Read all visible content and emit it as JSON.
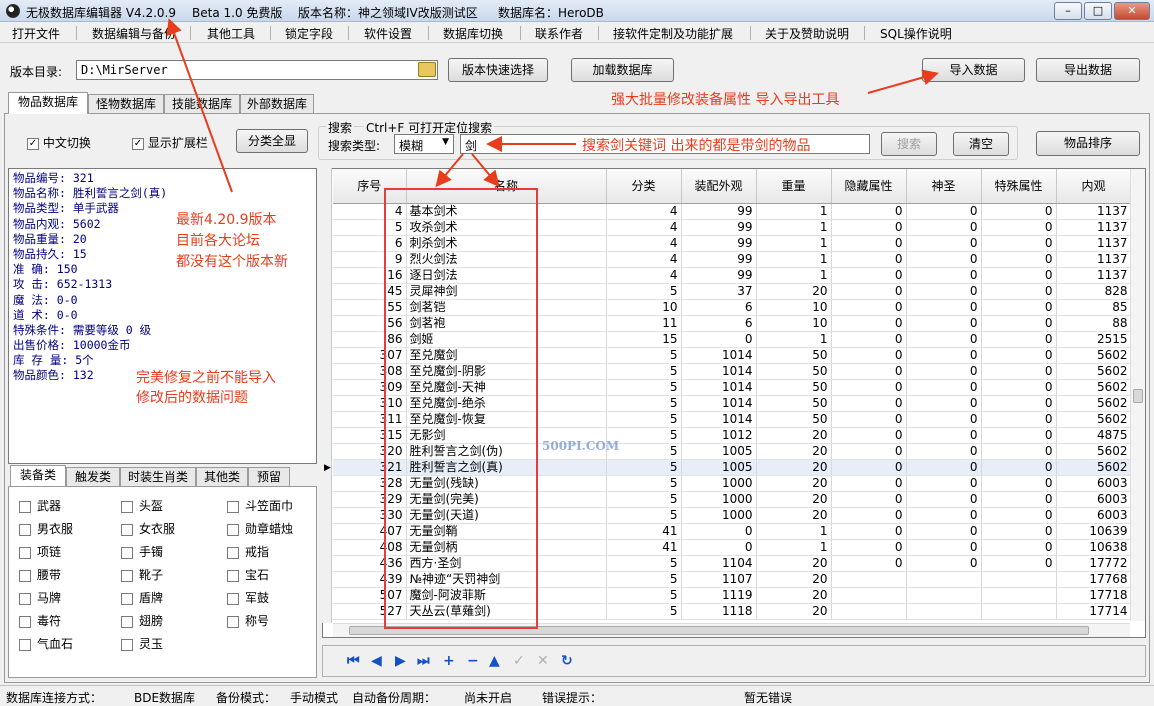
{
  "window": {
    "title": "无极数据库编辑器 V4.2.0.9",
    "edition": "Beta 1.0 免费版",
    "version_name": "版本名称：神之领域IV改版测试区",
    "db_name": "数据库名：HeroDB",
    "minimize": "–",
    "maximize": "□",
    "close": "✕"
  },
  "menu": [
    "打开文件",
    "数据编辑与备份",
    "其他工具",
    "锁定字段",
    "软件设置",
    "数据库切换",
    "联系作者",
    "接软件定制及功能扩展",
    "关于及赞助说明",
    "SQL操作说明"
  ],
  "toolbar": {
    "dir_label": "版本目录:",
    "dir_value": "D:\\MirServer",
    "quick_select": "版本快速选择",
    "load_db": "加载数据库",
    "import": "导入数据",
    "export": "导出数据"
  },
  "tabs": [
    "物品数据库",
    "怪物数据库",
    "技能数据库",
    "外部数据库"
  ],
  "options": {
    "chinese_toggle": "中文切换",
    "show_ext": "显示扩展栏",
    "category_all": "分类全显"
  },
  "search": {
    "title": "搜索",
    "hint": "Ctrl+F 可打开定位搜索",
    "type_label": "搜索类型:",
    "type_value": "模糊",
    "keyword": "剑",
    "search_btn": "搜索",
    "clear_btn": "清空",
    "sort_btn": "物品排序"
  },
  "item_info": [
    "物品编号: 321",
    "物品名称: 胜利誓言之剑(真)",
    "物品类型: 单手武器",
    "物品内观: 5602",
    "物品重量: 20",
    "物品持久: 15",
    "准    确: 150",
    "攻    击: 652-1313",
    "魔    法: 0-0",
    "道    术: 0-0",
    "特殊条件: 需要等级 0 级",
    "出售价格: 10000金币",
    "库 存 量: 5个",
    "物品颜色: 132"
  ],
  "category_tabs": [
    "装备类",
    "触发类",
    "时装生肖类",
    "其他类",
    "预留"
  ],
  "categories": [
    "武器",
    "头盔",
    "斗笠面巾",
    "男衣服",
    "女衣服",
    "勋章蜡烛",
    "项链",
    "手镯",
    "戒指",
    "腰带",
    "靴子",
    "宝石",
    "马牌",
    "盾牌",
    "军鼓",
    "毒符",
    "翅膀",
    "称号",
    "气血石",
    "灵玉"
  ],
  "grid": {
    "columns": [
      "序号",
      "名称",
      "分类",
      "装配外观",
      "重量",
      "隐藏属性",
      "神圣",
      "特殊属性",
      "内观"
    ],
    "rows": [
      [
        "4",
        "基本剑术",
        "4",
        "99",
        "1",
        "0",
        "0",
        "0",
        "1137"
      ],
      [
        "5",
        "攻杀剑术",
        "4",
        "99",
        "1",
        "0",
        "0",
        "0",
        "1137"
      ],
      [
        "6",
        "刺杀剑术",
        "4",
        "99",
        "1",
        "0",
        "0",
        "0",
        "1137"
      ],
      [
        "9",
        "烈火剑法",
        "4",
        "99",
        "1",
        "0",
        "0",
        "0",
        "1137"
      ],
      [
        "16",
        "逐日剑法",
        "4",
        "99",
        "1",
        "0",
        "0",
        "0",
        "1137"
      ],
      [
        "45",
        "灵犀神剑",
        "5",
        "37",
        "20",
        "0",
        "0",
        "0",
        "828"
      ],
      [
        "55",
        "剑茗铠",
        "10",
        "6",
        "10",
        "0",
        "0",
        "0",
        "85"
      ],
      [
        "56",
        "剑茗袍",
        "11",
        "6",
        "10",
        "0",
        "0",
        "0",
        "88"
      ],
      [
        "86",
        "剑姬",
        "15",
        "0",
        "1",
        "0",
        "0",
        "0",
        "2515"
      ],
      [
        "307",
        "至兑魔剑",
        "5",
        "1014",
        "50",
        "0",
        "0",
        "0",
        "5602"
      ],
      [
        "308",
        "至兑魔剑-阴影",
        "5",
        "1014",
        "50",
        "0",
        "0",
        "0",
        "5602"
      ],
      [
        "309",
        "至兑魔剑-天神",
        "5",
        "1014",
        "50",
        "0",
        "0",
        "0",
        "5602"
      ],
      [
        "310",
        "至兑魔剑-绝杀",
        "5",
        "1014",
        "50",
        "0",
        "0",
        "0",
        "5602"
      ],
      [
        "311",
        "至兑魔剑-恢复",
        "5",
        "1014",
        "50",
        "0",
        "0",
        "0",
        "5602"
      ],
      [
        "315",
        "无影剑",
        "5",
        "1012",
        "20",
        "0",
        "0",
        "0",
        "4875"
      ],
      [
        "320",
        "胜利誓言之剑(伪)",
        "5",
        "1005",
        "20",
        "0",
        "0",
        "0",
        "5602"
      ],
      [
        "321",
        "胜利誓言之剑(真)",
        "5",
        "1005",
        "20",
        "0",
        "0",
        "0",
        "5602"
      ],
      [
        "328",
        "无量剑(残缺)",
        "5",
        "1000",
        "20",
        "0",
        "0",
        "0",
        "6003"
      ],
      [
        "329",
        "无量剑(完美)",
        "5",
        "1000",
        "20",
        "0",
        "0",
        "0",
        "6003"
      ],
      [
        "330",
        "无量剑(天道)",
        "5",
        "1000",
        "20",
        "0",
        "0",
        "0",
        "6003"
      ],
      [
        "407",
        "无量剑鞘",
        "41",
        "0",
        "1",
        "0",
        "0",
        "0",
        "10639"
      ],
      [
        "408",
        "无量剑柄",
        "41",
        "0",
        "1",
        "0",
        "0",
        "0",
        "10638"
      ],
      [
        "436",
        "西方·圣剑",
        "5",
        "1104",
        "20",
        "0",
        "0",
        "0",
        "17772"
      ],
      [
        "439",
        "№神迹“天罚神剑",
        "5",
        "1107",
        "20",
        "",
        "",
        "",
        "17768"
      ],
      [
        "507",
        "魔剑-阿波菲斯",
        "5",
        "1119",
        "20",
        "",
        "",
        "",
        "17718"
      ],
      [
        "527",
        "天丛云(草薙剑)",
        "5",
        "1118",
        "20",
        "",
        "",
        "",
        "17714"
      ]
    ],
    "selected_row": 16
  },
  "annotations": {
    "bulk_edit": "强大批量修改装备属性 导入导出工具",
    "search_note": "搜索剑关键词 出来的都是带剑的物品",
    "version_note": [
      "最新4.20.9版本",
      "目前各大论坛",
      "都没有这个版本新"
    ],
    "fix_note": [
      "完美修复之前不能导入",
      "修改后的数据问题"
    ]
  },
  "watermark": "500PI.COM",
  "status": {
    "conn_label": "数据库连接方式：",
    "conn_value": "BDE数据库",
    "backup_label": "备份模式：",
    "backup_value": "手动模式",
    "auto_label": "自动备份周期：",
    "auto_value": "尚未开启",
    "err_label": "错误提示：",
    "err_value": "暂无错误"
  },
  "colors": {
    "annotation_red": "#e83c1c",
    "info_text": "#000080",
    "nav_blue": "#1450c8"
  }
}
